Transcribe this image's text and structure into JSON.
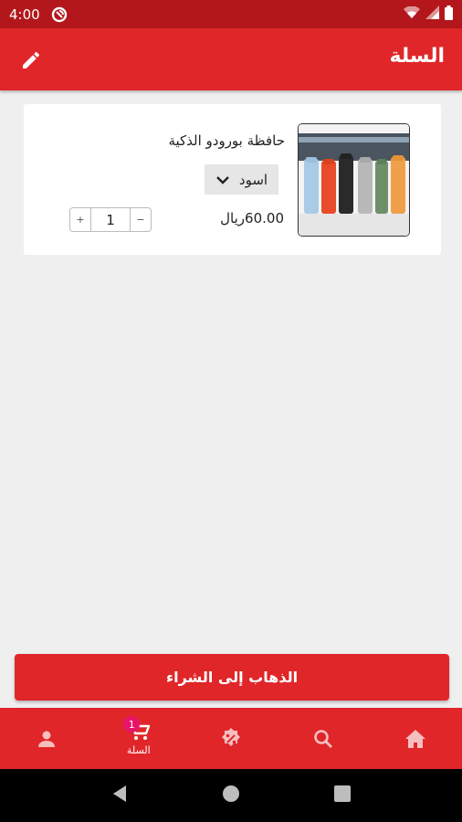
{
  "status_bar": {
    "time": "4:00"
  },
  "app_bar": {
    "title": "السلة"
  },
  "cart": {
    "items": [
      {
        "name": "حافظة بورودو الذكية",
        "variant": "اسود",
        "price": "60.00ريال",
        "quantity": "1",
        "minus": "−",
        "plus": "+"
      }
    ]
  },
  "checkout": {
    "label": "الذهاب إلى الشراء"
  },
  "bottom_nav": {
    "cart_label": "السلة",
    "cart_badge": "1"
  },
  "colors": {
    "primary": "#e02629",
    "status_bar": "#b3171b",
    "badge": "#e8136b"
  }
}
